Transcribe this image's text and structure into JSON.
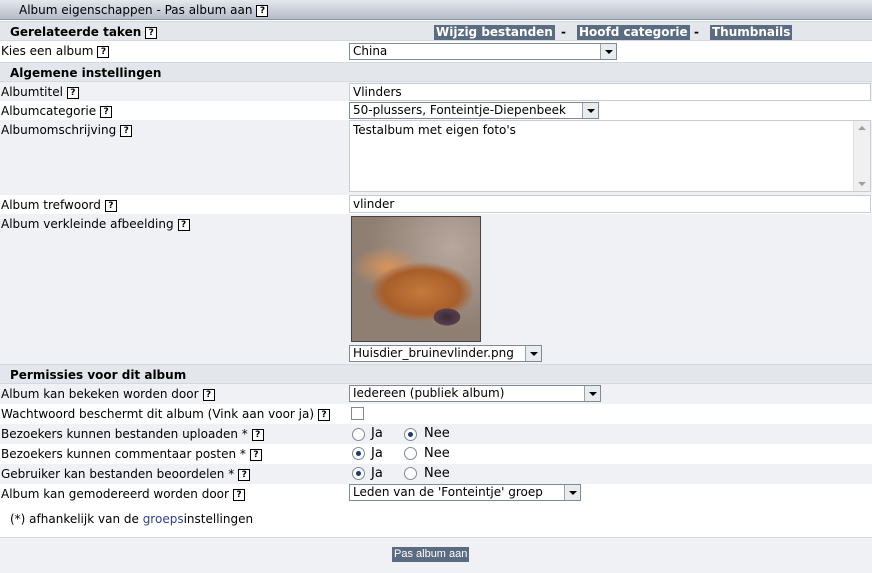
{
  "title": "Album eigenschappen - Pas album aan",
  "help_glyph": "?",
  "tasks": {
    "label": "Gerelateerde taken",
    "links": [
      "Wijzig bestanden",
      "Hoofd categorie",
      "Thumbnails"
    ],
    "separator": "-"
  },
  "choose_album": {
    "label": "Kies een album",
    "value": "China"
  },
  "general": {
    "heading": "Algemene instellingen",
    "title_label": "Albumtitel",
    "title_value": "Vlinders",
    "category_label": "Albumcategorie",
    "category_value": "50-plussers, Fonteintje-Diepenbeek",
    "description_label": "Albumomschrijving",
    "description_value": "Testalbum met eigen foto's",
    "keyword_label": "Album trefwoord",
    "keyword_value": "vlinder",
    "thumb_label": "Album verkleinde afbeelding",
    "thumb_file": "Huisdier_bruinevlinder.png"
  },
  "permissions": {
    "heading": "Permissies voor dit album",
    "view_label": "Album kan bekeken worden door",
    "view_value": "Iedereen (publiek album)",
    "password_label": "Wachtwoord beschermt dit album (Vink aan voor ja)",
    "password_checked": false,
    "upload_label": "Bezoekers kunnen bestanden uploaden *",
    "upload_value": "Nee",
    "comment_label": "Bezoekers kunnen commentaar posten *",
    "comment_value": "Ja",
    "rate_label": "Gebruiker kan bestanden beoordelen *",
    "rate_value": "Ja",
    "moderate_label": "Album kan gemodereerd worden door",
    "moderate_value": "Leden van de 'Fonteintje' groep",
    "yes": "Ja",
    "no": "Nee"
  },
  "footnote": {
    "prefix": "(*) afhankelijk van de ",
    "link": "groeps",
    "suffix": "instellingen"
  },
  "submit_label": "Pas album aan"
}
